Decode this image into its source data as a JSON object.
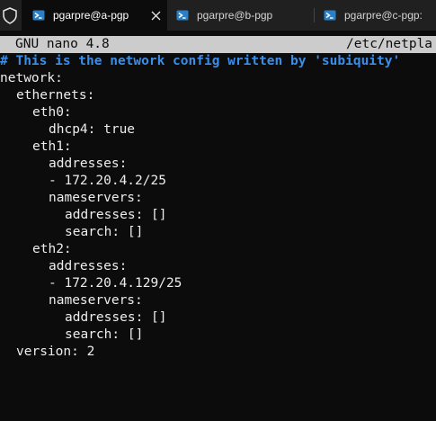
{
  "tabs": [
    {
      "title": "pgarpre@a-pgp",
      "active": true
    },
    {
      "title": "pgarpre@b-pgp",
      "active": false
    },
    {
      "title": "pgarpre@c-pgp:",
      "active": false
    }
  ],
  "nano": {
    "version": "GNU nano 4.8",
    "path": "/etc/netpla"
  },
  "lines": [
    "# This is the network config written by 'subiquity'",
    "network:",
    "ethernets:",
    "eth0:",
    "dhcp4: true",
    "eth1:",
    "addresses:",
    "- 172.20.4.2/25",
    "nameservers:",
    "addresses: []",
    "search: []",
    "eth2:",
    "addresses:",
    "- 172.20.4.129/25",
    "nameservers:",
    "addresses: []",
    "search: []",
    "version: 2"
  ],
  "colors": {
    "background": "#0c0c0c",
    "comment": "#3b8eea",
    "header_bg": "#cccccc"
  },
  "icons": [
    "shield-icon",
    "powershell-icon",
    "close-icon"
  ]
}
